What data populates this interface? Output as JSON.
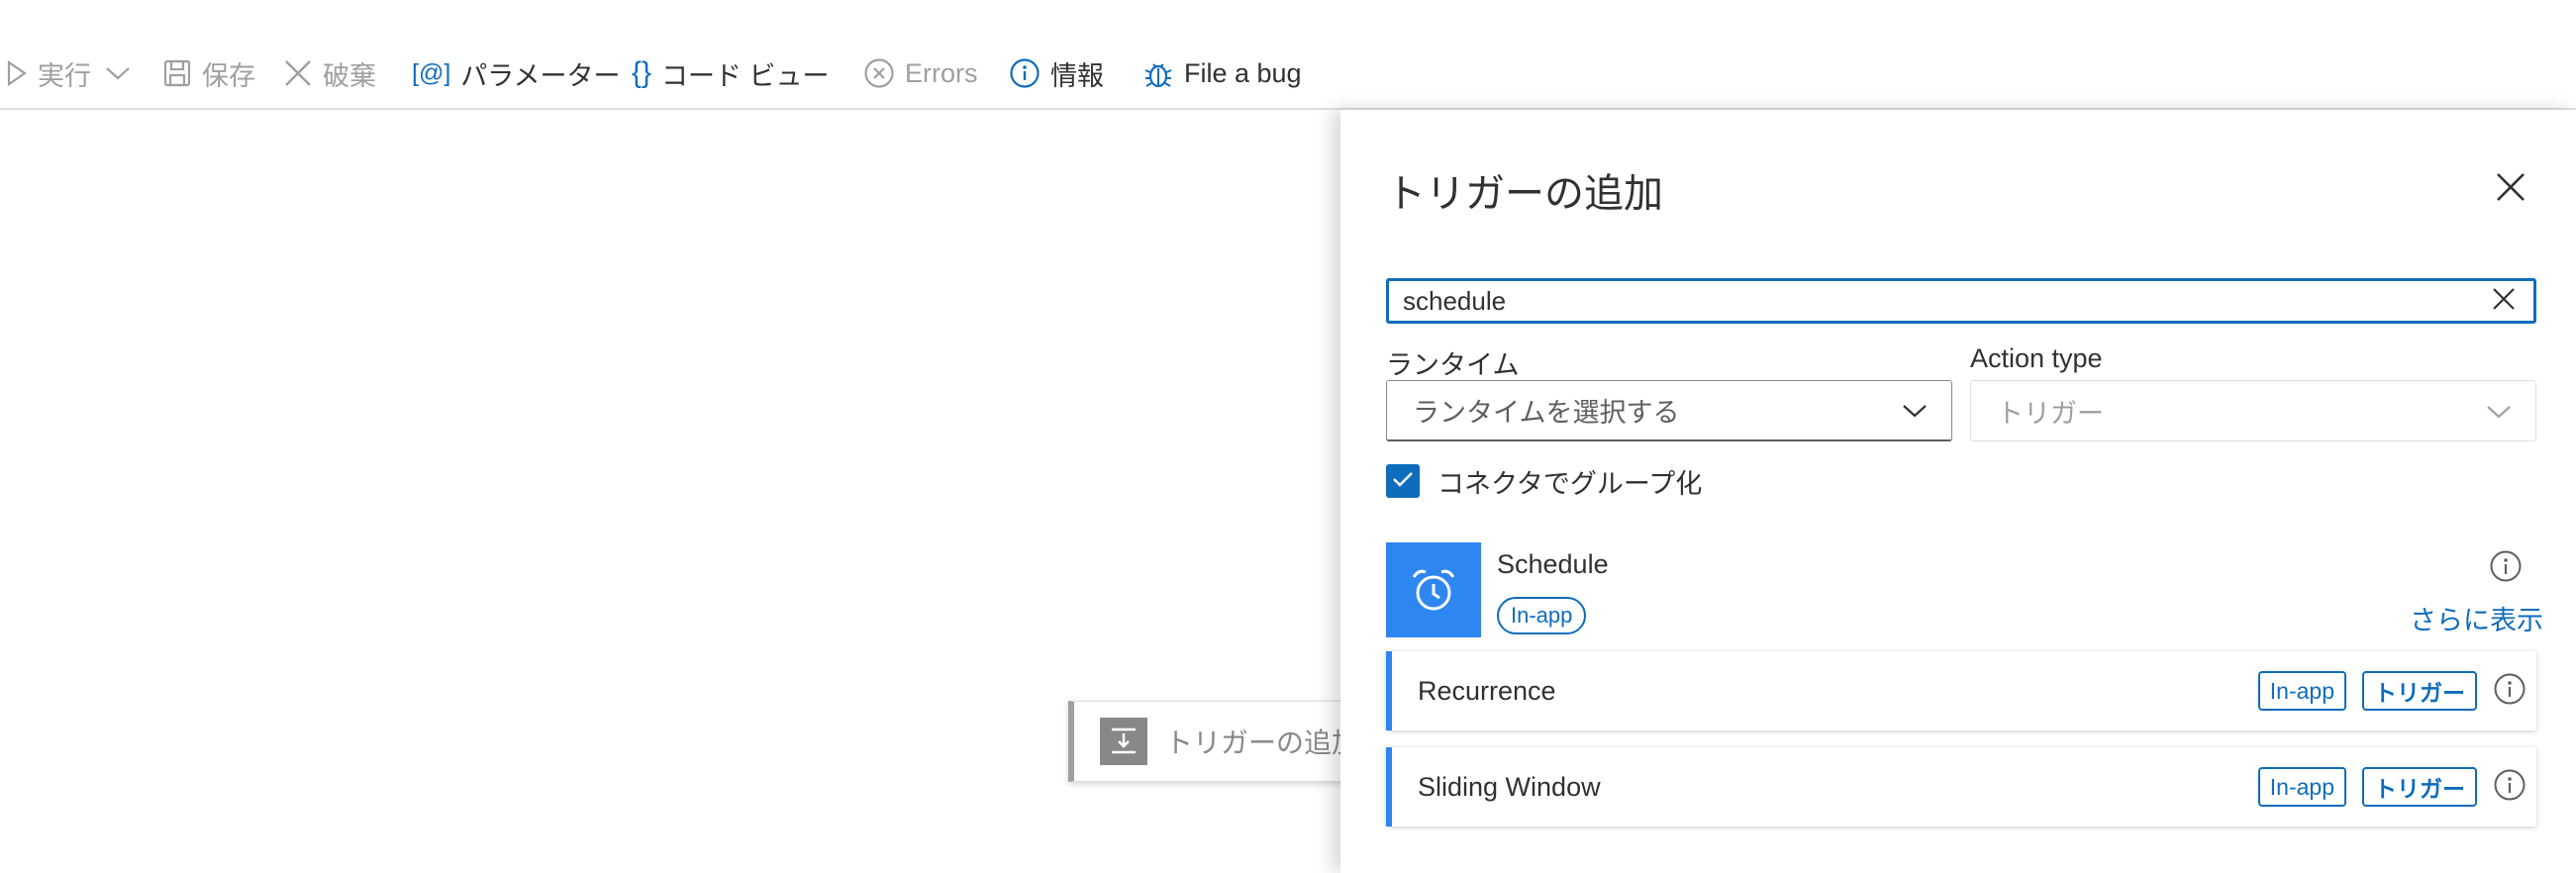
{
  "toolbar": {
    "run_label": "実行",
    "save_label": "保存",
    "discard_label": "破棄",
    "parameters_label": "パラメーター",
    "codeview_label": "コード ビュー",
    "errors_label": "Errors",
    "info_label": "情報",
    "bug_label": "File a bug"
  },
  "canvas": {
    "node_label": "トリガーの追加"
  },
  "panel": {
    "title": "トリガーの追加",
    "search_value": "schedule",
    "runtime_label": "ランタイム",
    "runtime_placeholder": "ランタイムを選択する",
    "action_type_label": "Action type",
    "action_type_value": "トリガー",
    "group_by_connector_label": "コネクタでグループ化",
    "group_by_connector_checked": true,
    "connector": {
      "name": "Schedule",
      "badge": "In-app",
      "show_more": "さらに表示",
      "icon": "alarm-clock-icon"
    },
    "operations": [
      {
        "name": "Recurrence",
        "badge": "In-app",
        "type": "トリガー"
      },
      {
        "name": "Sliding Window",
        "badge": "In-app",
        "type": "トリガー"
      }
    ]
  },
  "colors": {
    "accent": "#0f6cbd",
    "connector": "#2e86f0",
    "disabled_text": "#a19f9d"
  }
}
